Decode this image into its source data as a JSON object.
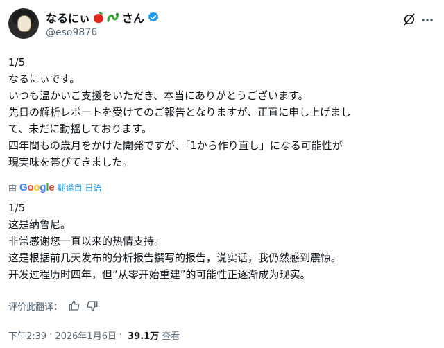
{
  "author": {
    "display_name": "なるにぃ",
    "name_suffix": "さん",
    "handle": "@eso9876"
  },
  "tweet": {
    "lines": [
      "1/5",
      "なるにぃです。",
      "いつも温かいご支援をいただき、本当にありがとうございます。",
      "先日の解析レポートを受けてのご報告となりますが、正直に申し上げまし",
      "て、未だに動揺しております。",
      "四年間もの歳月をかけた開発ですが、「1から作り直し」になる可能性が",
      "現実味を帯びてきました。"
    ]
  },
  "translation": {
    "by_label": "由",
    "google": [
      "G",
      "o",
      "o",
      "g",
      "l",
      "e"
    ],
    "google_colors": [
      "#4285F4",
      "#EA4335",
      "#FBBC05",
      "#4285F4",
      "#34A853",
      "#EA4335"
    ],
    "translate_link": "翻译自 日语",
    "lines": [
      "1/5",
      "这是纳鲁尼。",
      "非常感谢您一直以来的热情支持。",
      "这是根据前几天发布的分析报告撰写的报告，说实话，我仍然感到震惊。",
      "开发过程历时四年，但“从零开始重建”的可能性正逐渐成为现实。"
    ],
    "rate_label": "评价此翻译："
  },
  "meta": {
    "time": "下午2:39",
    "separator": "·",
    "date": "2026年1月6日",
    "views_count": "39.1万",
    "views_label": "查看"
  },
  "colors": {
    "accent": "#1d9bf0",
    "secondary_text": "#536471",
    "primary_text": "#0f1419"
  }
}
